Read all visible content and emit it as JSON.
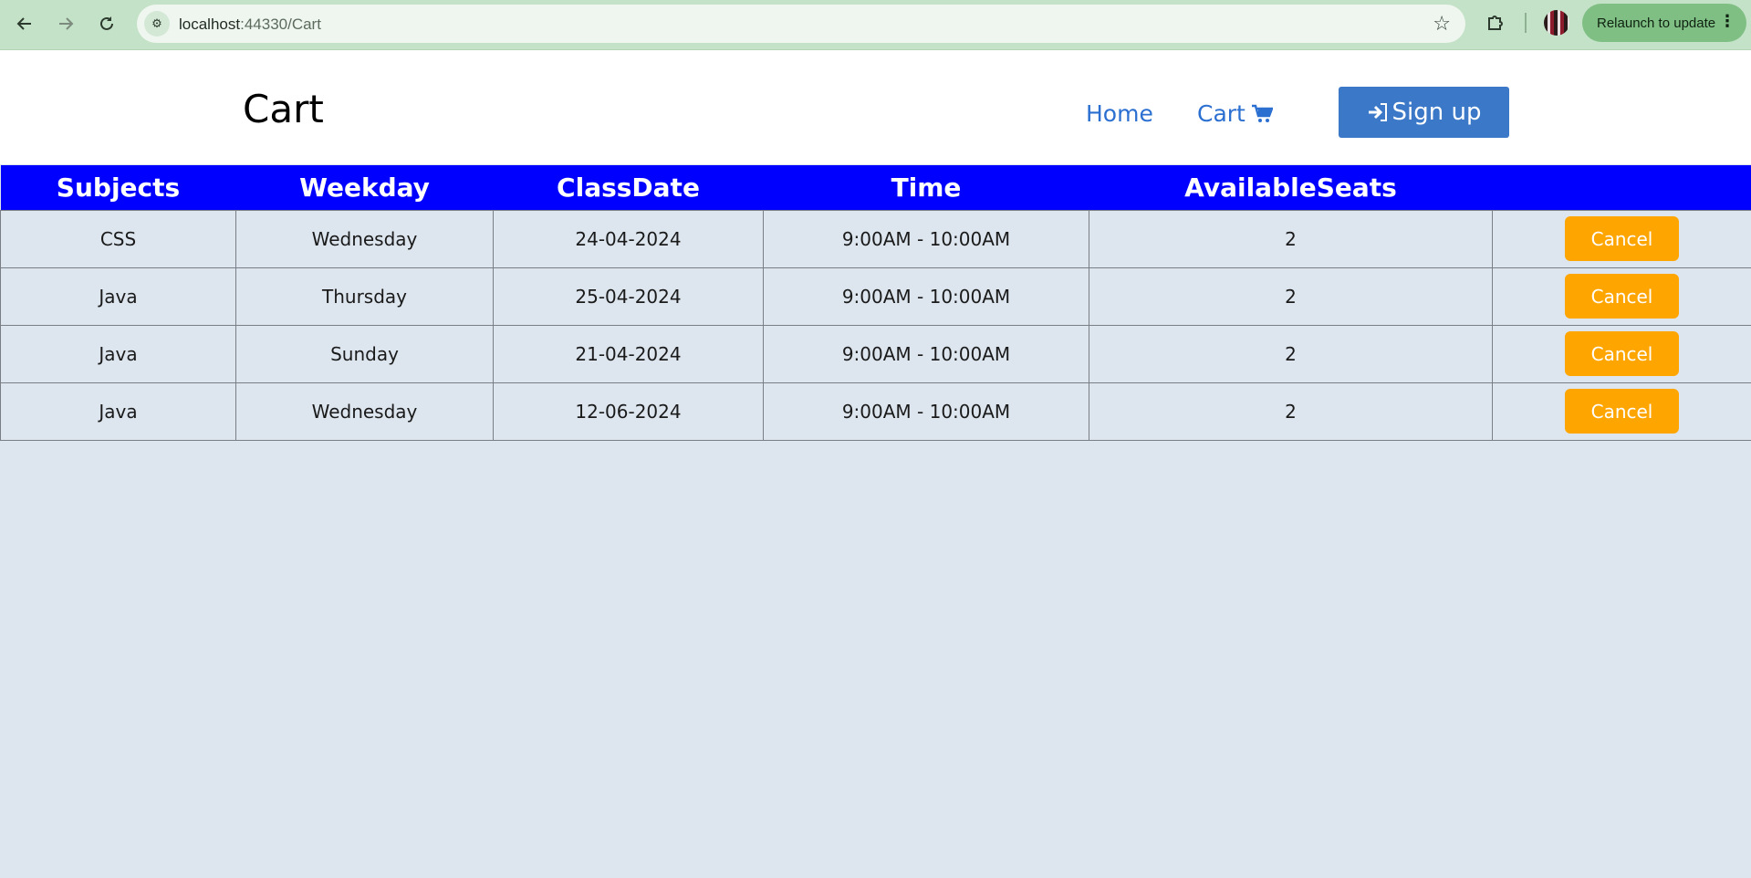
{
  "browser": {
    "url_host": "localhost",
    "url_rest": ":44330/Cart",
    "relaunch_label": "Relaunch to update"
  },
  "header": {
    "title": "Cart",
    "nav": {
      "home": "Home",
      "cart": "Cart",
      "signup": "Sign up"
    }
  },
  "table": {
    "columns": [
      "Subjects",
      "Weekday",
      "ClassDate",
      "Time",
      "AvailableSeats",
      ""
    ],
    "rows": [
      {
        "subject": "CSS",
        "weekday": "Wednesday",
        "date": "24-04-2024",
        "time": "9:00AM - 10:00AM",
        "seats": "2",
        "action": "Cancel"
      },
      {
        "subject": "Java",
        "weekday": "Thursday",
        "date": "25-04-2024",
        "time": "9:00AM - 10:00AM",
        "seats": "2",
        "action": "Cancel"
      },
      {
        "subject": "Java",
        "weekday": "Sunday",
        "date": "21-04-2024",
        "time": "9:00AM - 10:00AM",
        "seats": "2",
        "action": "Cancel"
      },
      {
        "subject": "Java",
        "weekday": "Wednesday",
        "date": "12-06-2024",
        "time": "9:00AM - 10:00AM",
        "seats": "2",
        "action": "Cancel"
      }
    ]
  },
  "colors": {
    "table_header": "#0000ff",
    "cancel_button": "#ffa500",
    "signup_button": "#3b78c8",
    "link": "#2b6fd1",
    "page_bg": "#dde6ef"
  }
}
